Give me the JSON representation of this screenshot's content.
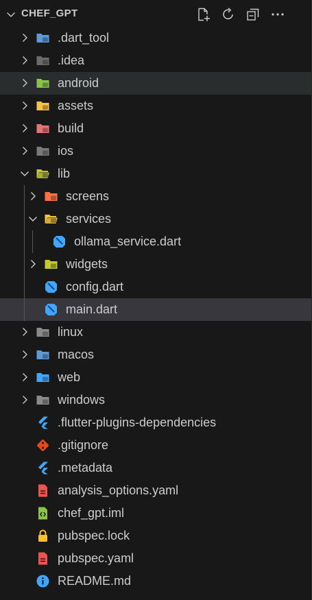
{
  "header": {
    "title": "CHEF_GPT",
    "actions": [
      "new-file-icon",
      "refresh-icon",
      "collapse-all-icon",
      "more-icon"
    ]
  },
  "tree": [
    {
      "label": ".dart_tool",
      "kind": "folder",
      "depth": 0,
      "expanded": false,
      "icon": "folder-dart-tool-icon",
      "color": "#5c9ad6"
    },
    {
      "label": ".idea",
      "kind": "folder",
      "depth": 0,
      "expanded": false,
      "icon": "folder-idea-icon",
      "color": "#6b6b6b"
    },
    {
      "label": "android",
      "kind": "folder",
      "depth": 0,
      "expanded": false,
      "icon": "folder-android-icon",
      "color": "#8bc34a",
      "state": "hover"
    },
    {
      "label": "assets",
      "kind": "folder",
      "depth": 0,
      "expanded": false,
      "icon": "folder-assets-icon",
      "color": "#f6c344"
    },
    {
      "label": "build",
      "kind": "folder",
      "depth": 0,
      "expanded": false,
      "icon": "folder-build-icon",
      "color": "#e57373"
    },
    {
      "label": "ios",
      "kind": "folder",
      "depth": 0,
      "expanded": false,
      "icon": "folder-ios-icon",
      "color": "#7a7a7a"
    },
    {
      "label": "lib",
      "kind": "folder",
      "depth": 0,
      "expanded": true,
      "icon": "folder-lib-icon",
      "color": "#c0ca33"
    },
    {
      "label": "screens",
      "kind": "folder",
      "depth": 1,
      "expanded": false,
      "icon": "folder-screens-icon",
      "color": "#ff7043"
    },
    {
      "label": "services",
      "kind": "folder",
      "depth": 1,
      "expanded": true,
      "icon": "folder-services-icon",
      "color": "#f6c344"
    },
    {
      "label": "ollama_service.dart",
      "kind": "file",
      "depth": 2,
      "icon": "dart-file-icon",
      "color": "#42a5f5"
    },
    {
      "label": "widgets",
      "kind": "folder",
      "depth": 1,
      "expanded": false,
      "icon": "folder-widgets-icon",
      "color": "#c0ca33"
    },
    {
      "label": "config.dart",
      "kind": "file",
      "depth": 1,
      "icon": "dart-file-icon",
      "color": "#42a5f5"
    },
    {
      "label": "main.dart",
      "kind": "file",
      "depth": 1,
      "icon": "dart-file-icon",
      "color": "#42a5f5",
      "state": "active"
    },
    {
      "label": "linux",
      "kind": "folder",
      "depth": 0,
      "expanded": false,
      "icon": "folder-linux-icon",
      "color": "#8a8a8a"
    },
    {
      "label": "macos",
      "kind": "folder",
      "depth": 0,
      "expanded": false,
      "icon": "folder-macos-icon",
      "color": "#5c9ad6"
    },
    {
      "label": "web",
      "kind": "folder",
      "depth": 0,
      "expanded": false,
      "icon": "folder-web-icon",
      "color": "#42a5f5"
    },
    {
      "label": "windows",
      "kind": "folder",
      "depth": 0,
      "expanded": false,
      "icon": "folder-windows-icon",
      "color": "#8a8a8a"
    },
    {
      "label": ".flutter-plugins-dependencies",
      "kind": "file",
      "depth": 0,
      "icon": "flutter-file-icon",
      "color": "#42a5f5"
    },
    {
      "label": ".gitignore",
      "kind": "file",
      "depth": 0,
      "icon": "git-file-icon",
      "color": "#e64a19"
    },
    {
      "label": ".metadata",
      "kind": "file",
      "depth": 0,
      "icon": "flutter-file-icon",
      "color": "#42a5f5"
    },
    {
      "label": "analysis_options.yaml",
      "kind": "file",
      "depth": 0,
      "icon": "yaml-file-icon",
      "color": "#ef5350"
    },
    {
      "label": "chef_gpt.iml",
      "kind": "file",
      "depth": 0,
      "icon": "iml-file-icon",
      "color": "#8bc34a"
    },
    {
      "label": "pubspec.lock",
      "kind": "file",
      "depth": 0,
      "icon": "lock-file-icon",
      "color": "#fbc02d"
    },
    {
      "label": "pubspec.yaml",
      "kind": "file",
      "depth": 0,
      "icon": "yaml-file-icon",
      "color": "#ef5350"
    },
    {
      "label": "README.md",
      "kind": "file",
      "depth": 0,
      "icon": "info-file-icon",
      "color": "#42a5f5"
    }
  ]
}
